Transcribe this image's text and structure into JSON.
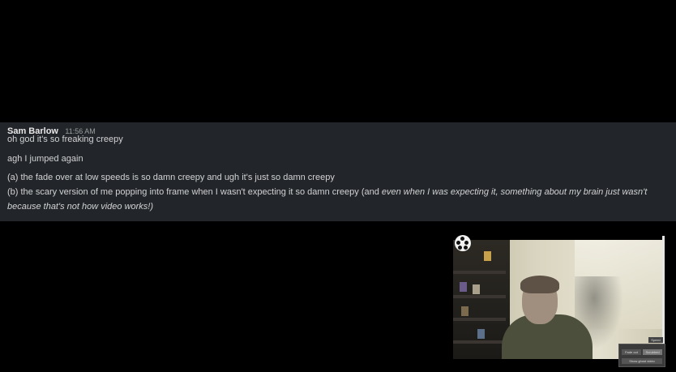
{
  "message": {
    "author": "Sam Barlow",
    "timestamp": "11:56 AM",
    "lines": [
      "oh god it's so freaking creepy",
      "agh I jumped again",
      "(a) the fade over at low speeds is so damn creepy and ugh it's just so damn creepy",
      "(b) the scary version of me popping into frame when I wasn't expecting it so damn creepy (and ",
      "because that's not how video works!)"
    ],
    "line4_italic": "even when I was expecting it, something about my brain just wasn't"
  },
  "video": {
    "icon": "film-reel-icon",
    "controls": {
      "top": "Speed",
      "left": "Fade out",
      "right": "Scrubbed",
      "bottom": "Show ghost video"
    }
  },
  "colors": {
    "background": "#000000",
    "message_bg": "#222529",
    "text": "#d1d2d3"
  }
}
